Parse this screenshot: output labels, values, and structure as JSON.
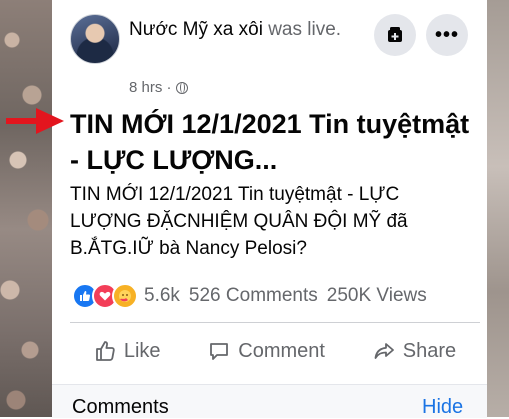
{
  "post": {
    "author": "Nước Mỹ xa xôi",
    "author_suffix": " was live.",
    "time": "8 hrs ·",
    "title": "TIN MỚI 12/1/2021 Tin tuyệtmật - LỰC LƯỢNG...",
    "body": "TIN MỚI 12/1/2021 Tin tuyệtmật - LỰC LƯỢNG ĐẶCNHIỆM QUÂN ĐỘI MỸ đã B.ẮTG.IỮ bà Nancy Pelosi?"
  },
  "header_icons": {
    "save_icon": "save-bookmark-icon",
    "more_label": "•••"
  },
  "stats": {
    "reactions": [
      "like",
      "love",
      "care"
    ],
    "reaction_count": "5.6k",
    "comments": "526 Comments",
    "views": "250K Views"
  },
  "actions": {
    "like": "Like",
    "comment": "Comment",
    "share": "Share"
  },
  "comments_section": {
    "label": "Comments",
    "hide": "Hide"
  },
  "colors": {
    "accent_red_arrow": "#e3151e",
    "link_blue": "#1b74e4",
    "secondary_text": "#65676b"
  }
}
